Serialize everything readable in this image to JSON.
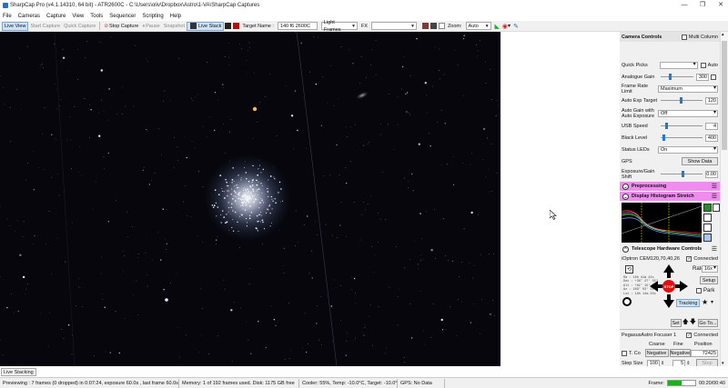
{
  "window": {
    "title": "SharpCap Pro (v4.1.14310, 64 bit) - ATR2600C - C:\\Users\\oliv\\Dropbox\\Astro\\1-VA\\SharpCap Captures",
    "minimize": "—",
    "maximize": "❐",
    "close": "✕"
  },
  "menu": [
    "File",
    "Cameras",
    "Capture",
    "View",
    "Tools",
    "Sequencer",
    "Scripting",
    "Help"
  ],
  "toolbar": {
    "live_view": "Live View",
    "start_capture": "Start Capture",
    "quick_capture": "Quick Capture",
    "stop_capture": "Stop Capture",
    "pause": "Pause",
    "snapshot": "Snapshot",
    "live_stack": "Live Stack",
    "target_name_label": "Target Name :",
    "target_name_value": "140 f6 2600C",
    "frame_type": "Light Frames",
    "fx_label": "FX",
    "zoom_label": "Zoom:",
    "zoom_value": "Auto"
  },
  "panel": {
    "camera_controls": "Camera Controls",
    "multi_column": "Multi Column",
    "quick_picks": "Quick Picks",
    "auto_label": "Auto",
    "rows": [
      {
        "label": "Analogue Gain",
        "value": "300",
        "type": "slider",
        "pos": 0.25,
        "auto": true
      },
      {
        "label": "Frame Rate Limit",
        "value": "Maximum",
        "type": "combo"
      },
      {
        "label": "Auto Exp Target",
        "value": "120",
        "type": "slider",
        "pos": 0.45
      },
      {
        "label": "Auto Gain with Auto Exposure",
        "value": "Off",
        "type": "combo"
      },
      {
        "label": "USB Speed",
        "value": "4",
        "type": "slider",
        "pos": 0.1
      },
      {
        "label": "Black Level",
        "value": "400",
        "type": "slider",
        "pos": 0.05
      },
      {
        "label": "Status LEDs",
        "value": "On",
        "type": "combo"
      },
      {
        "label": "GPS",
        "value": "Show Data",
        "type": "button"
      },
      {
        "label": "Exposure/Gain Shift",
        "value": "0.00",
        "type": "slider",
        "pos": 0.5
      }
    ],
    "preprocessing": "Preprocessing",
    "histogram": "Display Histogram Stretch",
    "telescope": "Telescope Hardware Controls",
    "mount": "iOptron CEM120,70,40,26",
    "connected": "Connected",
    "rate_label": "Rate:",
    "rate_value": "16x",
    "setup": "Setup",
    "park": "Park",
    "tracking": "Tracking",
    "set": "Set",
    "goto": "Go To...",
    "stop": "STOP",
    "coords": [
      "Ra  : 16h 41m 42s",
      "Dec : +36° 27' 35\"",
      "Alt : +61° 15' 08\"",
      "Az  : 269° 03' 21\"",
      "Lst : 18h 14m 33s"
    ],
    "focuser": "PegasusAstro Focuser 1",
    "coarse": "Coarse",
    "fine": "Fine",
    "position": "Position",
    "tcomp": "T. Co",
    "negative": "Negative",
    "position_value": "72425",
    "step_size_label": "Step Size",
    "step_size": "100",
    "step_mult": "5",
    "stop_focuser": "Stop"
  },
  "status": {
    "live_stacking": "Live Stacking",
    "previewing": "Previewing : 7 frames (0 dropped) in 0:07:24, exposure 60.0s , last frame 60.0s",
    "memory": "Memory: 1 of 192 frames used. Disk: 1175 GB free",
    "cooler": "Cooler: 55%, Temp: -10.0°C, Target: -10.0°",
    "gps": "GPS: No Data",
    "frame_label": "Frame:",
    "time": "00:20/00:40"
  },
  "colors": {
    "accent_pink": "#f08cf0",
    "stop_red": "#e01010",
    "histogram_bg": "#000000",
    "active_blue": "#cfe3f7"
  }
}
